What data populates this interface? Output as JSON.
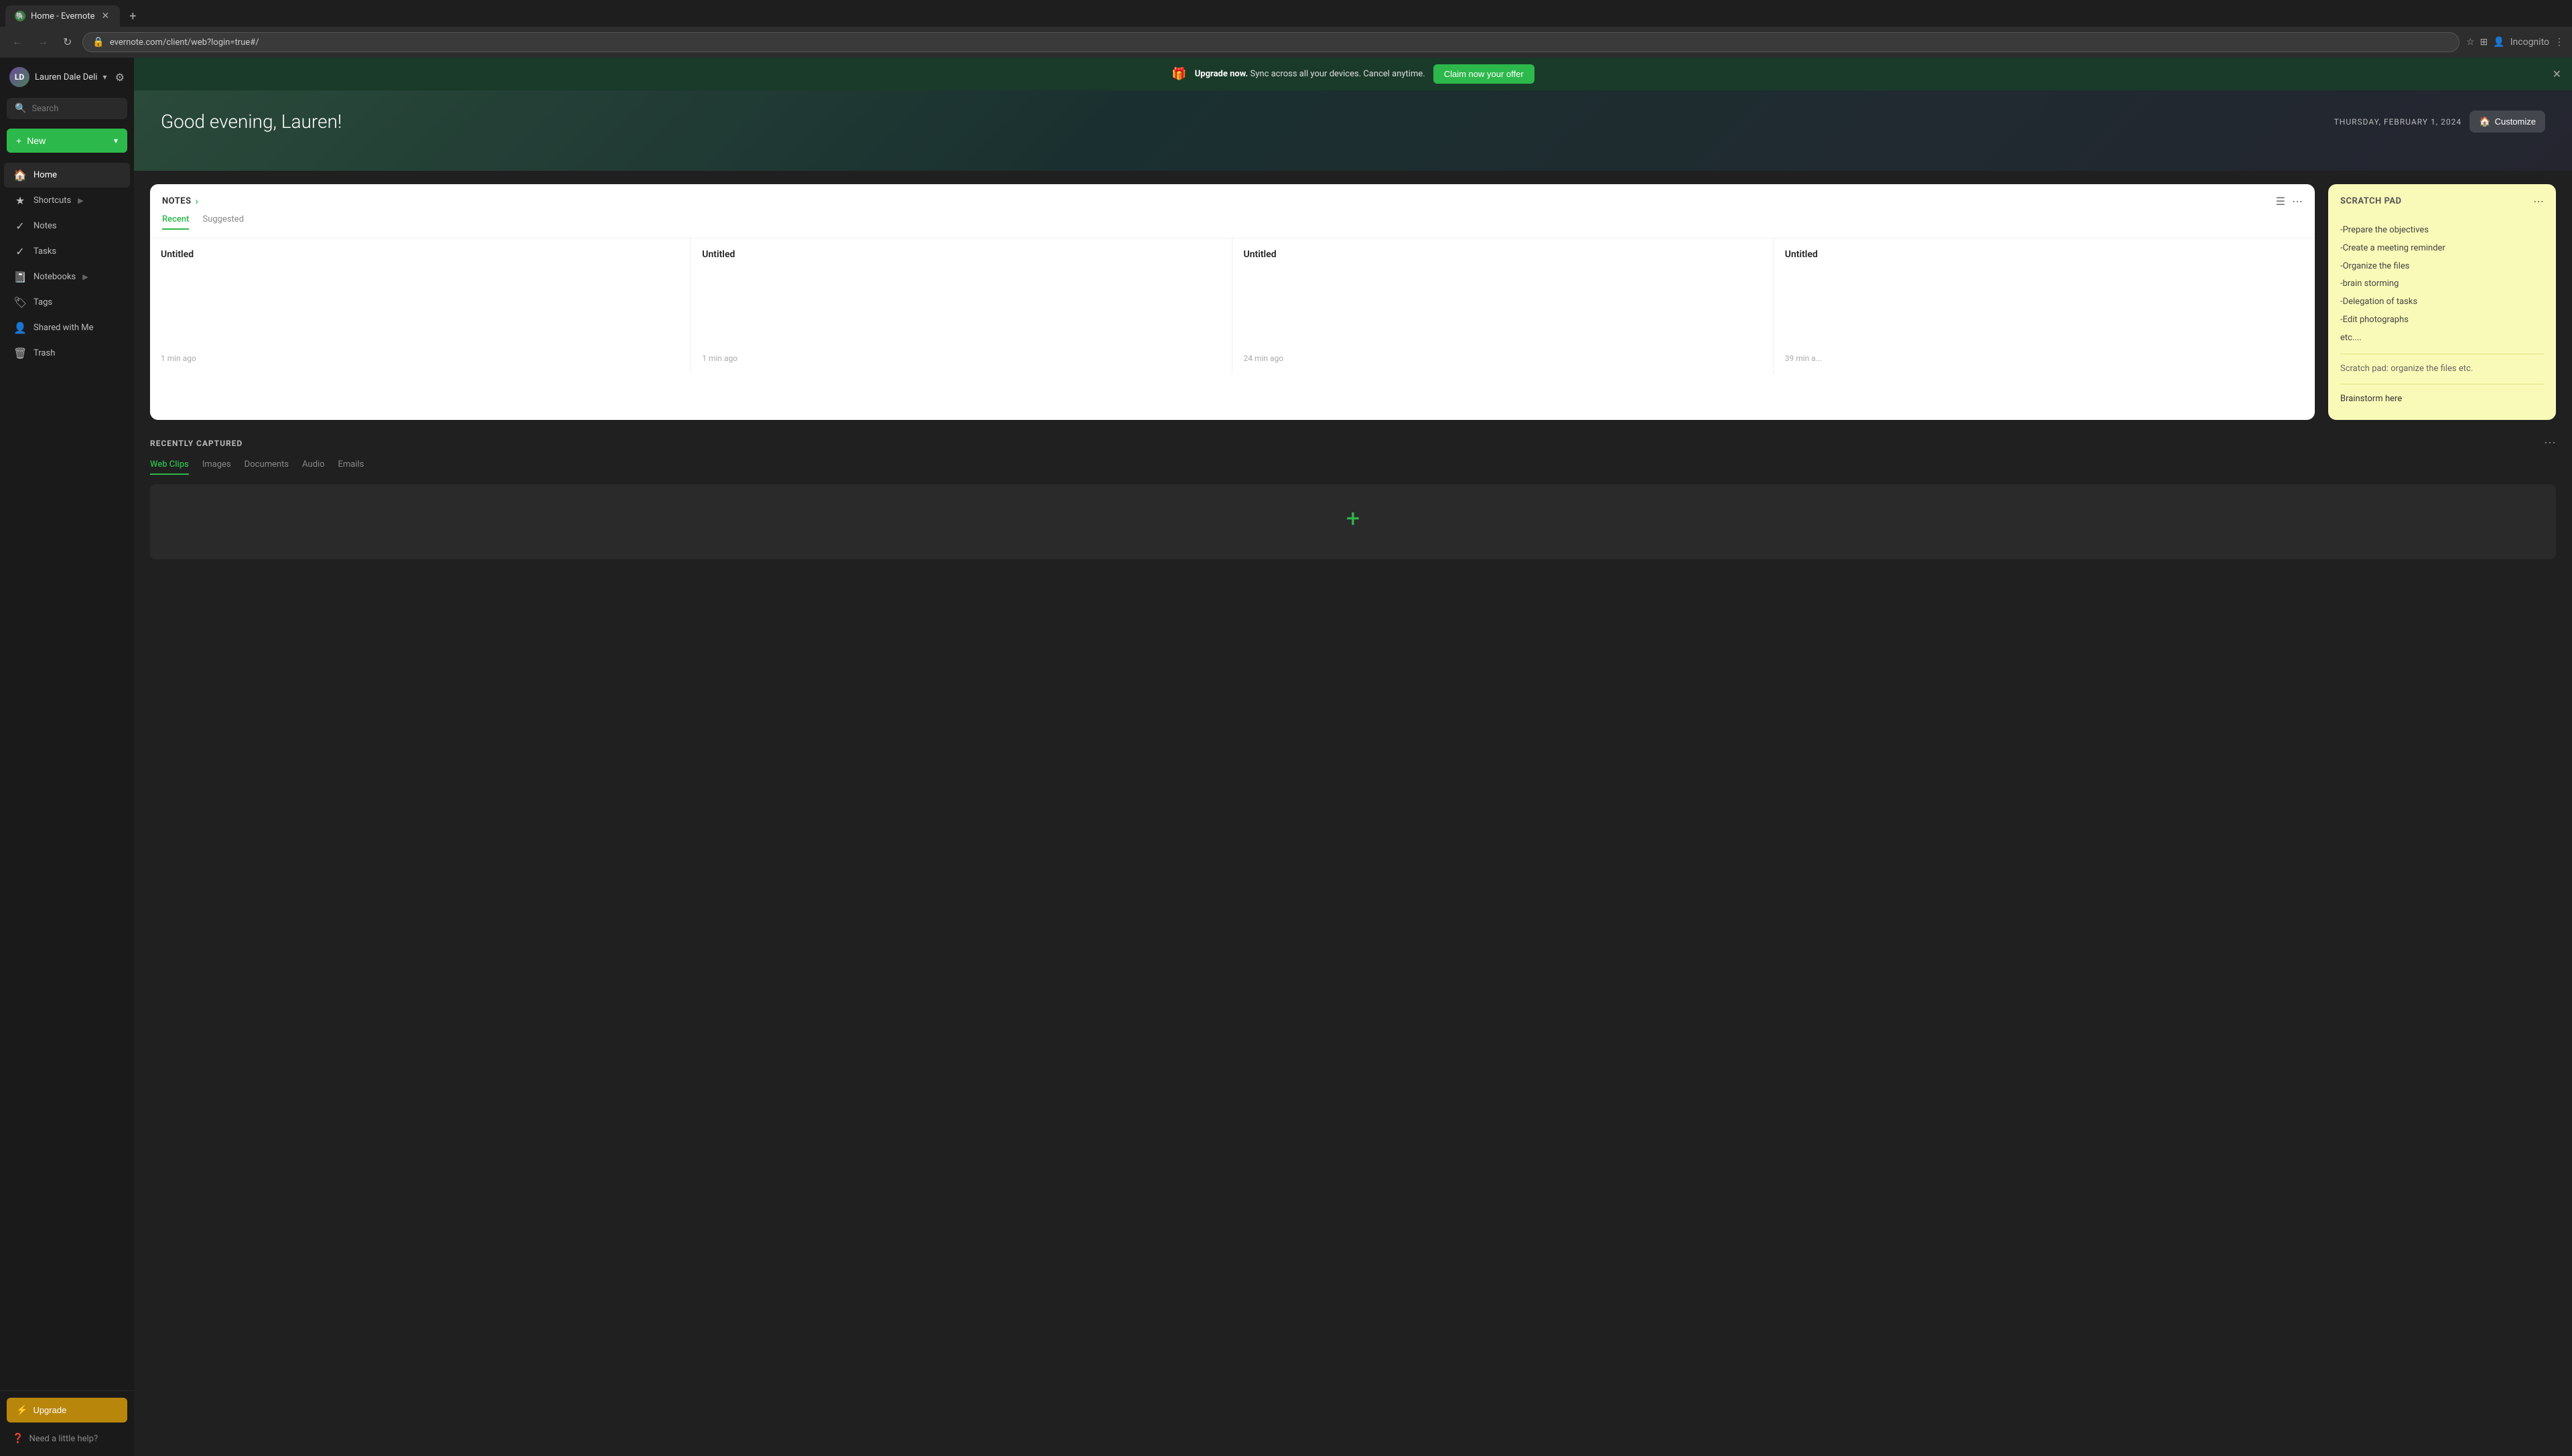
{
  "browser": {
    "tab_favicon": "🐘",
    "tab_title": "Home - Evernote",
    "url": "evernote.com/client/web?login=true#/",
    "url_full": "evernote.com/client/web?login=true#/",
    "incognito_label": "Incognito"
  },
  "promo": {
    "icon": "🎁",
    "text_prefix": "Upgrade now.",
    "text_body": " Sync across all your devices. Cancel anytime.",
    "cta_label": "Claim now your offer",
    "close_icon": "✕"
  },
  "hero": {
    "greeting": "Good evening, Lauren!",
    "date": "THURSDAY, FEBRUARY 1, 2024",
    "customize_label": "Customize",
    "customize_icon": "🏠"
  },
  "sidebar": {
    "username": "Lauren Dale Deli",
    "chevron": "▾",
    "settings_icon": "⚙",
    "search_placeholder": "Search",
    "new_label": "New",
    "new_chevron": "▾",
    "nav_items": [
      {
        "id": "home",
        "icon": "🏠",
        "label": "Home"
      },
      {
        "id": "shortcuts",
        "icon": "★",
        "label": "Shortcuts",
        "expand": "▶"
      },
      {
        "id": "notes",
        "icon": "✓",
        "label": "Notes"
      },
      {
        "id": "tasks",
        "icon": "✓",
        "label": "Tasks"
      },
      {
        "id": "notebooks",
        "icon": "📓",
        "label": "Notebooks",
        "expand": "▶"
      },
      {
        "id": "tags",
        "icon": "🏷",
        "label": "Tags"
      },
      {
        "id": "shared",
        "icon": "👤",
        "label": "Shared with Me"
      },
      {
        "id": "trash",
        "icon": "🗑",
        "label": "Trash"
      }
    ],
    "upgrade_label": "Upgrade",
    "upgrade_icon": "⚡",
    "help_label": "Need a little help?",
    "help_icon": "?"
  },
  "notes_card": {
    "title": "NOTES",
    "arrow": "›",
    "tabs": [
      {
        "id": "recent",
        "label": "Recent",
        "active": true
      },
      {
        "id": "suggested",
        "label": "Suggested",
        "active": false
      }
    ],
    "notes": [
      {
        "title": "Untitled",
        "body": "",
        "time": "1 min ago"
      },
      {
        "title": "Untitled",
        "body": "",
        "time": "1 min ago"
      },
      {
        "title": "Untitled",
        "body": "",
        "time": "24 min ago"
      },
      {
        "title": "Untitled",
        "body": "",
        "time": "39 min a..."
      }
    ]
  },
  "scratch_pad": {
    "title": "SCRATCH PAD",
    "items": [
      "-Prepare the objectives",
      "-Create a meeting reminder",
      "-Organize the files",
      "-brain storming",
      "-Delegation of tasks",
      "-Edit photographs",
      "etc...."
    ],
    "note": "Scratch pad: organize the files etc.",
    "brainstorm": "Brainstorm here"
  },
  "recently_captured": {
    "title": "RECENTLY CAPTURED",
    "tabs": [
      {
        "id": "web-clips",
        "label": "Web Clips",
        "active": true
      },
      {
        "id": "images",
        "label": "Images",
        "active": false
      },
      {
        "id": "documents",
        "label": "Documents",
        "active": false
      },
      {
        "id": "audio",
        "label": "Audio",
        "active": false
      },
      {
        "id": "emails",
        "label": "Emails",
        "active": false
      }
    ],
    "add_icon": "+"
  },
  "colors": {
    "accent_green": "#2db84b",
    "upgrade_gold": "#b8860b",
    "scratch_bg": "#fafab8"
  }
}
